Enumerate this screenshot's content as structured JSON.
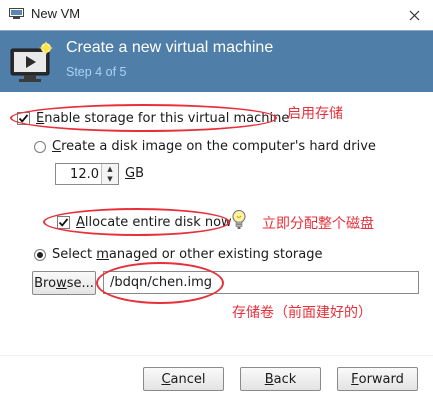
{
  "window": {
    "title": "New VM"
  },
  "banner": {
    "title": "Create a new virtual machine",
    "step": "Step 4 of 5"
  },
  "storage": {
    "enable_prefix": "",
    "enable_mnemonic": "E",
    "enable_rest": "nable storage for this virtual machine",
    "create_prefix": "",
    "create_mnemonic": "C",
    "create_rest": "reate a disk image on the computer's hard drive",
    "size_value": "12.0",
    "unit_mnemonic": "G",
    "unit_rest": "B",
    "allocate_prefix": "",
    "allocate_mnemonic": "A",
    "allocate_rest": "llocate entire disk now",
    "managed_prefix": "Select ",
    "managed_mnemonic": "m",
    "managed_rest": "anaged or other existing storage",
    "browse_prefix": "Bro",
    "browse_mnemonic": "w",
    "browse_rest": "se...",
    "path_value": "/bdqn/chen.img",
    "enable_checked": true,
    "allocate_checked": true,
    "create_selected": false,
    "managed_selected": true
  },
  "annotations": {
    "enable": "启用存储",
    "allocate": "立即分配整个磁盘",
    "volume": "存储卷（前面建好的）",
    "color": "#e8303a"
  },
  "footer": {
    "cancel_prefix": "",
    "cancel_mnemonic": "C",
    "cancel_rest": "ancel",
    "back_prefix": "",
    "back_mnemonic": "B",
    "back_rest": "ack",
    "forward_prefix": "",
    "forward_mnemonic": "F",
    "forward_rest": "orward"
  }
}
